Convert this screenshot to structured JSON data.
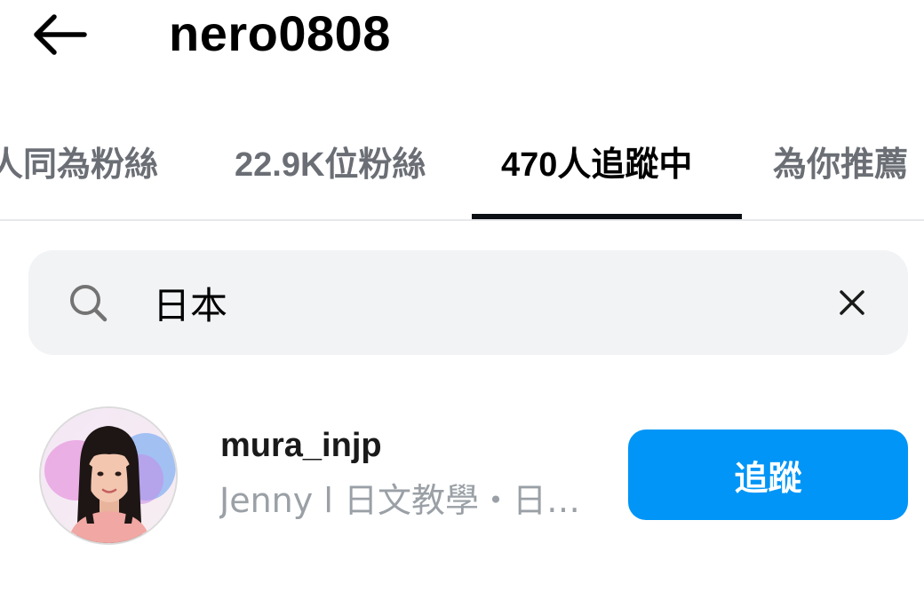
{
  "header": {
    "title": "nero0808",
    "back_icon": "arrow-left-icon"
  },
  "tabs": [
    {
      "label": "人同為粉絲",
      "active": false
    },
    {
      "label": "22.9K位粉絲",
      "active": false
    },
    {
      "label": "470人追蹤中",
      "active": true
    },
    {
      "label": "為你推薦",
      "active": false
    }
  ],
  "search": {
    "value": "日本",
    "icon": "search-icon",
    "clear_icon": "close-icon"
  },
  "results": [
    {
      "username": "mura_injp",
      "bio": "Jenny l 日文教學・日本生活",
      "follow_label": "追蹤"
    }
  ],
  "colors": {
    "accent": "#0095f6",
    "tab_indicator": "#0c1014",
    "muted_text": "#6b6f75",
    "search_bg": "#f2f3f5"
  }
}
